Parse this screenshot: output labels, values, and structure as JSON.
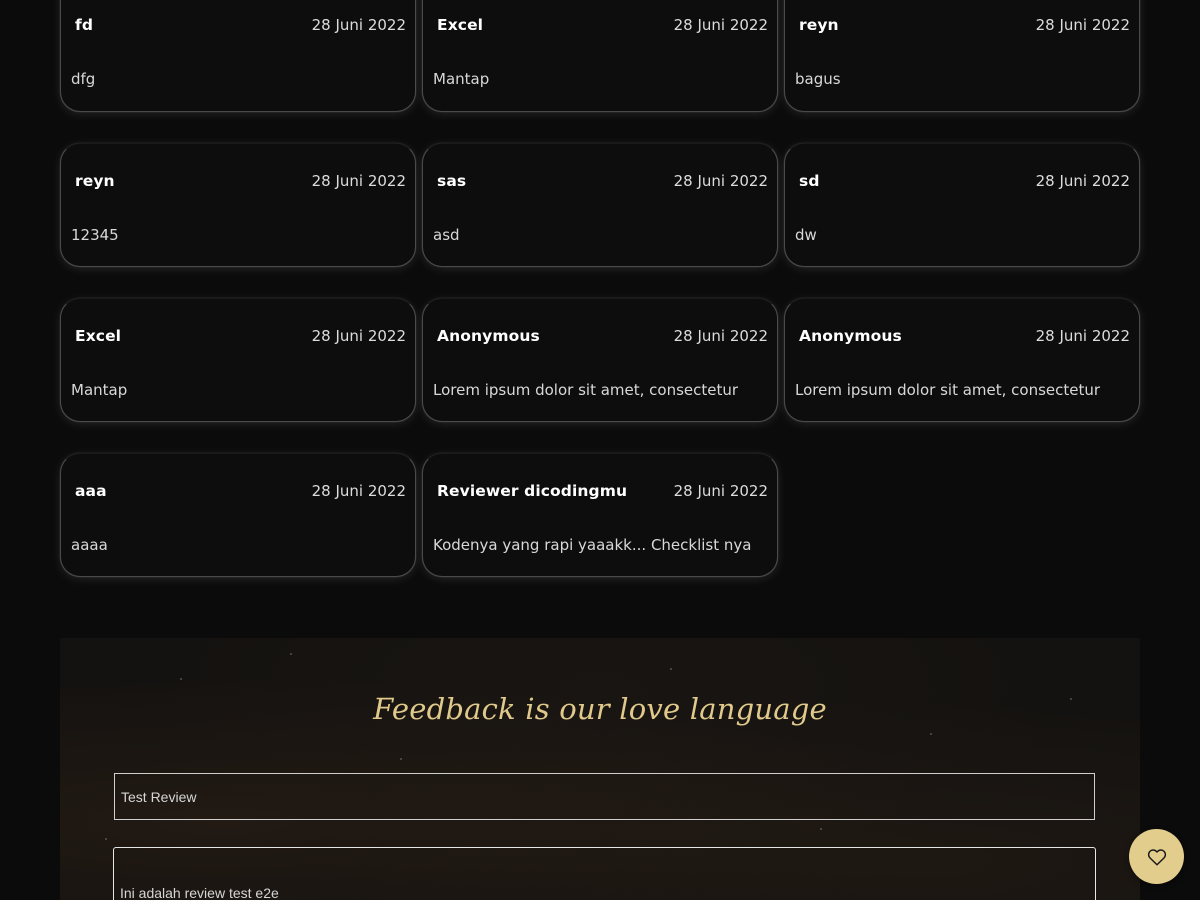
{
  "reviews": [
    {
      "name": "fd",
      "date": "28 Juni 2022",
      "text": "dfg"
    },
    {
      "name": "Excel",
      "date": "28 Juni 2022",
      "text": "Mantap"
    },
    {
      "name": "reyn",
      "date": "28 Juni 2022",
      "text": "bagus"
    },
    {
      "name": "reyn",
      "date": "28 Juni 2022",
      "text": "12345"
    },
    {
      "name": "sas",
      "date": "28 Juni 2022",
      "text": "asd"
    },
    {
      "name": "sd",
      "date": "28 Juni 2022",
      "text": "dw"
    },
    {
      "name": "Excel",
      "date": "28 Juni 2022",
      "text": "Mantap"
    },
    {
      "name": "Anonymous",
      "date": "28 Juni 2022",
      "text": "Lorem ipsum dolor sit amet, consectetur"
    },
    {
      "name": "Anonymous",
      "date": "28 Juni 2022",
      "text": "Lorem ipsum dolor sit amet, consectetur"
    },
    {
      "name": "aaa",
      "date": "28 Juni 2022",
      "text": "aaaa"
    },
    {
      "name": "Reviewer dicodingmu",
      "date": "28 Juni 2022",
      "text": "Kodenya yang rapi yaaakk... Checklist nya"
    }
  ],
  "feedback": {
    "title": "Feedback is our love language",
    "name_value": "Test Review",
    "review_value": "Ini adalah review test e2e"
  },
  "fab": {
    "icon": "heart-icon"
  },
  "colors": {
    "background": "#0b0b0b",
    "accent_gold": "#e0c98a",
    "fab_background": "#e2cd8c"
  }
}
